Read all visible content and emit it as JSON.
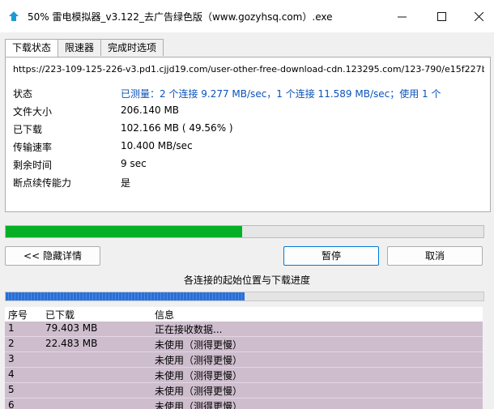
{
  "window": {
    "title": "50% 雷电模拟器_v3.122_去广告绿色版（www.gozyhsq.com）.exe"
  },
  "tabs": [
    {
      "label": "下载状态",
      "active": true
    },
    {
      "label": "限速器",
      "active": false
    },
    {
      "label": "完成时选项",
      "active": false
    }
  ],
  "download": {
    "url": "https://223-109-125-226-v3.pd1.cjjd19.com/user-other-free-download-cdn.123295.com/123-790/e15f227b/16257",
    "rows": [
      {
        "label": "状态",
        "value": "已测量：2 个连接 9.277 MB/sec，1 个连接 11.589 MB/sec；使用 1 个"
      },
      {
        "label": "文件大小",
        "value": "206.140 MB"
      },
      {
        "label": "已下载",
        "value": "102.166 MB  ( 49.56% )"
      },
      {
        "label": "传输速率",
        "value": "10.400 MB/sec"
      },
      {
        "label": "剩余时间",
        "value": "9 sec"
      },
      {
        "label": "断点续传能力",
        "value": "是"
      }
    ],
    "progress_fraction": 0.4956
  },
  "buttons": {
    "hide_details": "<< 隐藏详情",
    "pause": "暂停",
    "cancel": "取消"
  },
  "connections": {
    "caption": "各连接的起始位置与下载进度",
    "segment_progress_fraction": 0.5,
    "columns": [
      "序号",
      "已下载",
      "信息"
    ],
    "rows": [
      {
        "no": "1",
        "downloaded": "79.403 MB",
        "info": "正在接收数据..."
      },
      {
        "no": "2",
        "downloaded": "22.483 MB",
        "info": "未使用（测得更慢）"
      },
      {
        "no": "3",
        "downloaded": "",
        "info": "未使用（测得更慢）"
      },
      {
        "no": "4",
        "downloaded": "",
        "info": "未使用（测得更慢）"
      },
      {
        "no": "5",
        "downloaded": "",
        "info": "未使用（测得更慢）"
      },
      {
        "no": "6",
        "downloaded": "",
        "info": "未使用（测得更慢）"
      }
    ]
  },
  "colors": {
    "progress_green": "#06b025",
    "status_blue": "#0a52b8",
    "row_bg": "#cdbdcd",
    "segment_blue": "#2a6fd6"
  }
}
